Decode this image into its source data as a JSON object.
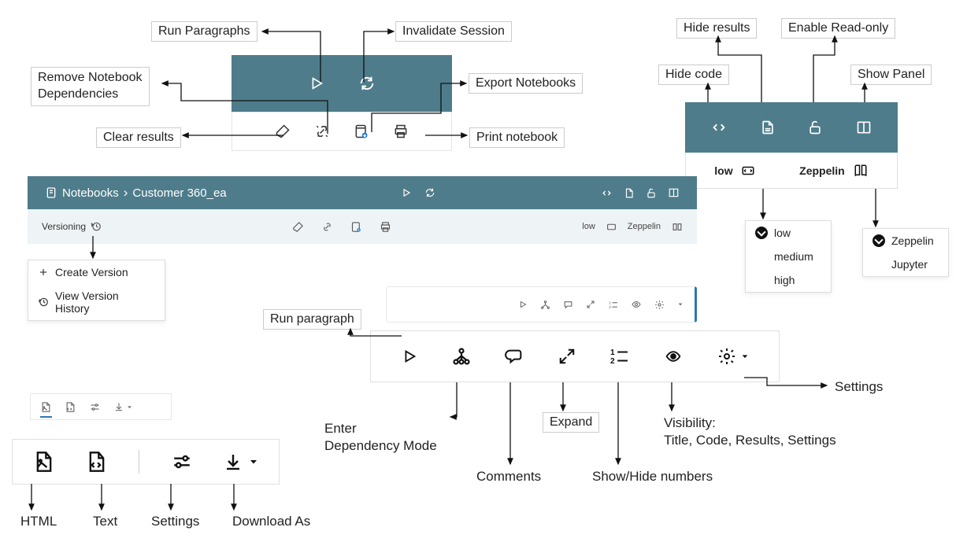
{
  "callouts": {
    "run_paragraphs": "Run Paragraphs",
    "invalidate_session": "Invalidate Session",
    "remove_deps": "Remove Notebook\nDependencies",
    "export_notebooks": "Export Notebooks",
    "clear_results": "Clear results",
    "print_notebook": "Print notebook",
    "hide_code": "Hide code",
    "hide_results": "Hide results",
    "enable_readonly": "Enable Read-only",
    "show_panel": "Show Panel",
    "run_paragraph_single": "Run paragraph",
    "enter_dep_mode": "Enter\nDependency Mode",
    "comments": "Comments",
    "expand": "Expand",
    "show_hide_numbers": "Show/Hide numbers",
    "visibility": "Visibility:\nTitle, Code, Results, Settings",
    "settings": "Settings",
    "html": "HTML",
    "text": "Text",
    "settings2": "Settings",
    "download_as": "Download As"
  },
  "header": {
    "breadcrumb_root": "Notebooks",
    "sep": "›",
    "title": "Customer 360_ea"
  },
  "versioning": {
    "label": "Versioning",
    "create": "Create Version",
    "history": "View Version History"
  },
  "width_menu": {
    "current": "low",
    "options": [
      "low",
      "medium",
      "high"
    ]
  },
  "layout_menu": {
    "current": "Zeppelin",
    "options": [
      "Zeppelin",
      "Jupyter"
    ]
  },
  "mini_bar": {
    "low": "low",
    "zeppelin": "Zeppelin"
  }
}
